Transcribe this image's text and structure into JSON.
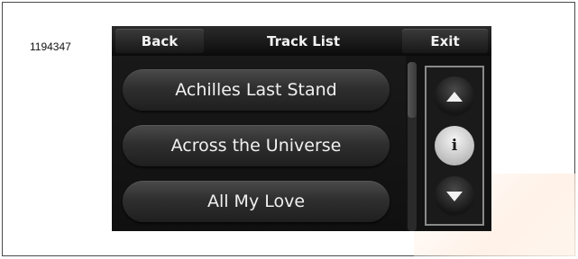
{
  "figure_number": "1194347",
  "header": {
    "back_label": "Back",
    "title": "Track List",
    "exit_label": "Exit"
  },
  "tracks": [
    {
      "label": "Achilles Last Stand"
    },
    {
      "label": "Across the Universe"
    },
    {
      "label": "All My Love"
    }
  ],
  "controls": {
    "up_icon": "triangle-up-icon",
    "info_label": "i",
    "down_icon": "triangle-down-icon"
  },
  "colors": {
    "screen_background": "#121212",
    "button_text": "#f2f2f2",
    "control_border": "#8a8a8a",
    "info_button": "#d8d8d8"
  }
}
